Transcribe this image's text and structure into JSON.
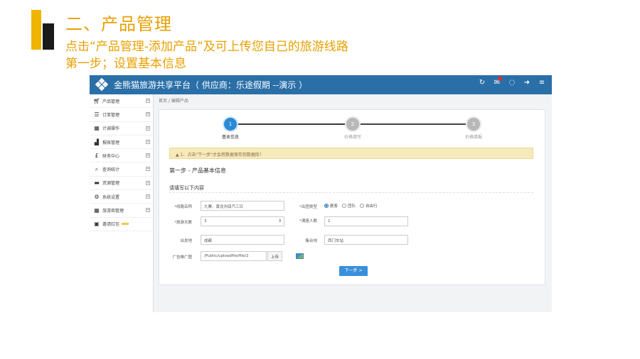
{
  "slide": {
    "title": "二、产品管理",
    "line1": "点击“产品管理-添加产品”及可上传您自己的旅游线路",
    "line2": "第一步；设置基本信息"
  },
  "app": {
    "title": "金熊猫旅游共享平台（ 供应商：乐途假期 --演示 ）",
    "top_icons": [
      "refresh-icon",
      "mail-icon",
      "chat-icon",
      "logout-icon",
      "menu-icon"
    ],
    "sidebar": [
      {
        "label": "产品管理",
        "icon": "cart-icon"
      },
      {
        "label": "订单管理",
        "icon": "list-icon"
      },
      {
        "label": "计调操作",
        "icon": "calendar-icon"
      },
      {
        "label": "报账管理",
        "icon": "chart-icon"
      },
      {
        "label": "财务中心",
        "icon": "pound-icon"
      },
      {
        "label": "查询统计",
        "icon": "search-icon"
      },
      {
        "label": "资源管理",
        "icon": "folder-icon"
      },
      {
        "label": "系统设置",
        "icon": "gear-icon"
      },
      {
        "label": "旅游商管理",
        "icon": "calendar-icon"
      },
      {
        "label": "邀请红包",
        "icon": "gift-icon"
      }
    ],
    "breadcrumb": "首页 / 编辑产品",
    "steps": [
      {
        "num": "1",
        "label": "基本信息"
      },
      {
        "num": "2",
        "label": "价格填写"
      },
      {
        "num": "3",
        "label": "价格填报"
      }
    ],
    "notice": "▲ 1、点击\"下一步\"才会将数据保存到数据库！",
    "step_heading": "第一步 - 产品基本信息",
    "section_heading": "请填写以下内容",
    "form": {
      "route_name": {
        "label": "线路名称",
        "value": "九寨、黄龙沟双汽三日"
      },
      "group_type": {
        "label": "出团类型",
        "options": [
          "散客",
          "团队",
          "自由行"
        ],
        "selected": "散客"
      },
      "days": {
        "label": "旅游天数",
        "value": "3"
      },
      "min_people": {
        "label": "满座人数",
        "value": "1"
      },
      "departure": {
        "label": "出发地",
        "value": "成都"
      },
      "gathering": {
        "label": "集合地",
        "value": "西门车站"
      },
      "ad_image": {
        "label": "广告推广图",
        "value": "/Public/uploadfile/file/2",
        "button": "上传"
      }
    },
    "next_button": "下一步 >"
  }
}
